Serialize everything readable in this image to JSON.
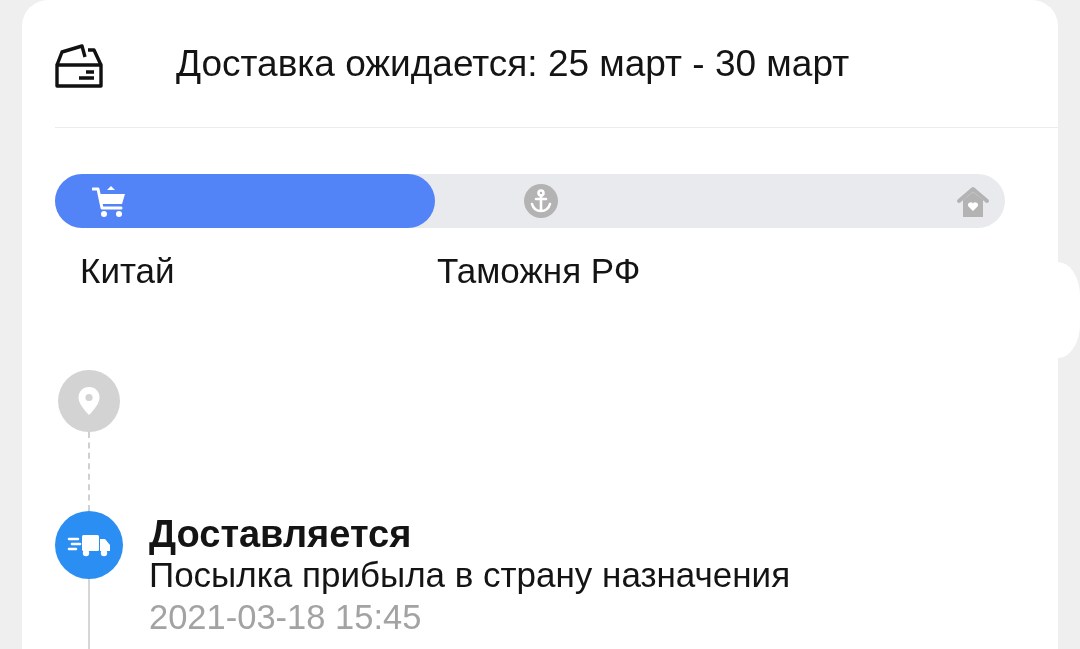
{
  "delivery_estimate": "Доставка ожидается: 25 март - 30 март",
  "route": {
    "level": 0.4,
    "stops": [
      {
        "kind": "cart",
        "label": "Китай",
        "reached": true
      },
      {
        "kind": "anchor",
        "label": "Таможня РФ",
        "reached": false
      },
      {
        "kind": "home",
        "reached": false
      }
    ]
  },
  "timeline": [
    {
      "kind": "location",
      "current": false
    },
    {
      "kind": "transit",
      "current": true,
      "title": "Доставляется",
      "text": "Посылка прибыла в страну назначения",
      "time": "2021-03-18 15:45"
    }
  ]
}
